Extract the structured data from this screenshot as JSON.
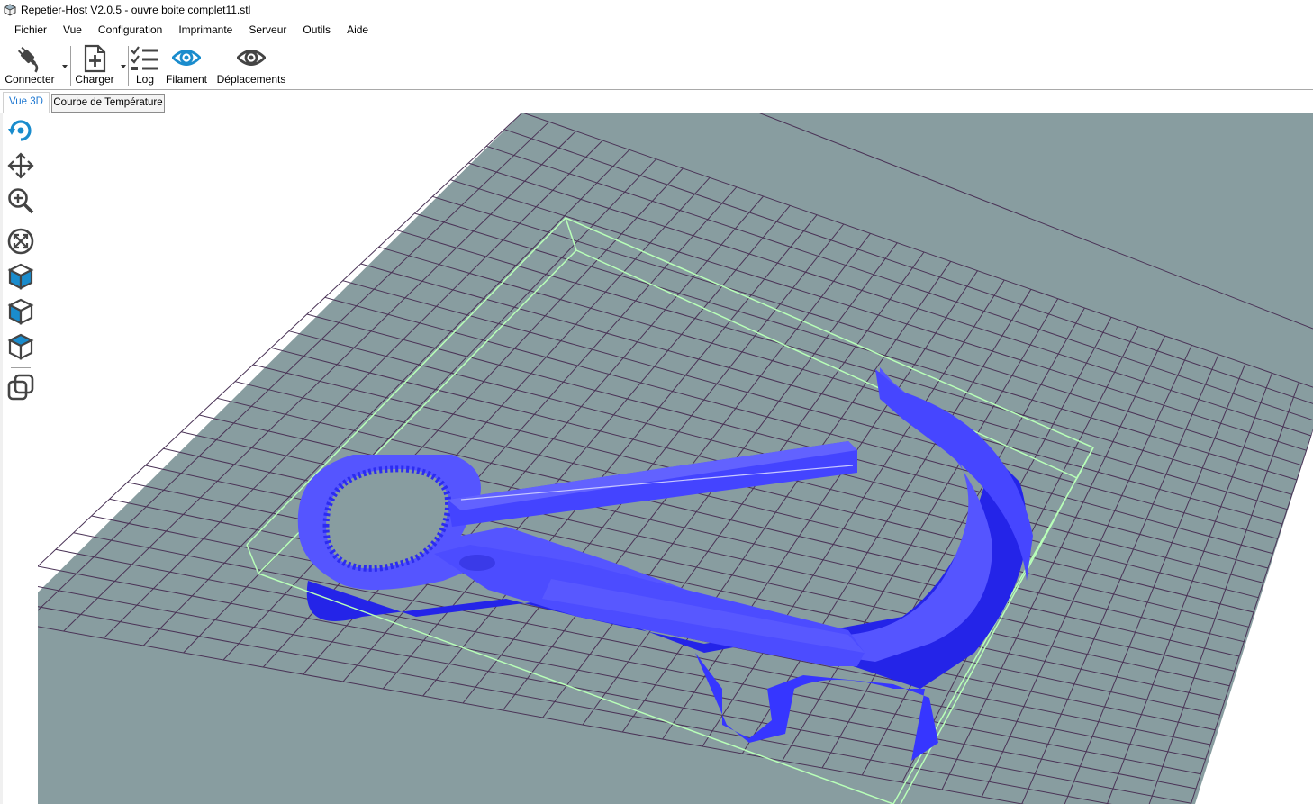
{
  "window": {
    "title": "Repetier-Host V2.0.5 - ouvre boite complet11.stl"
  },
  "menu": [
    "Fichier",
    "Vue",
    "Configuration",
    "Imprimante",
    "Serveur",
    "Outils",
    "Aide"
  ],
  "toolbar": {
    "connect": "Connecter",
    "load": "Charger",
    "log": "Log",
    "filament": "Filament",
    "moves": "Déplacements"
  },
  "tabs": [
    "Vue 3D",
    "Courbe de Température"
  ],
  "side_tools": [
    "rotate-icon",
    "move-icon",
    "zoom-icon",
    "fit-view-icon",
    "iso-view-icon",
    "front-view-icon",
    "top-view-icon",
    "parallel-projection-icon"
  ],
  "colors": {
    "accent": "#1a8ccd",
    "bed": "#889da0",
    "grid": "#4a3356",
    "model": "#3333ff",
    "bbox": "#b8ffb8"
  }
}
